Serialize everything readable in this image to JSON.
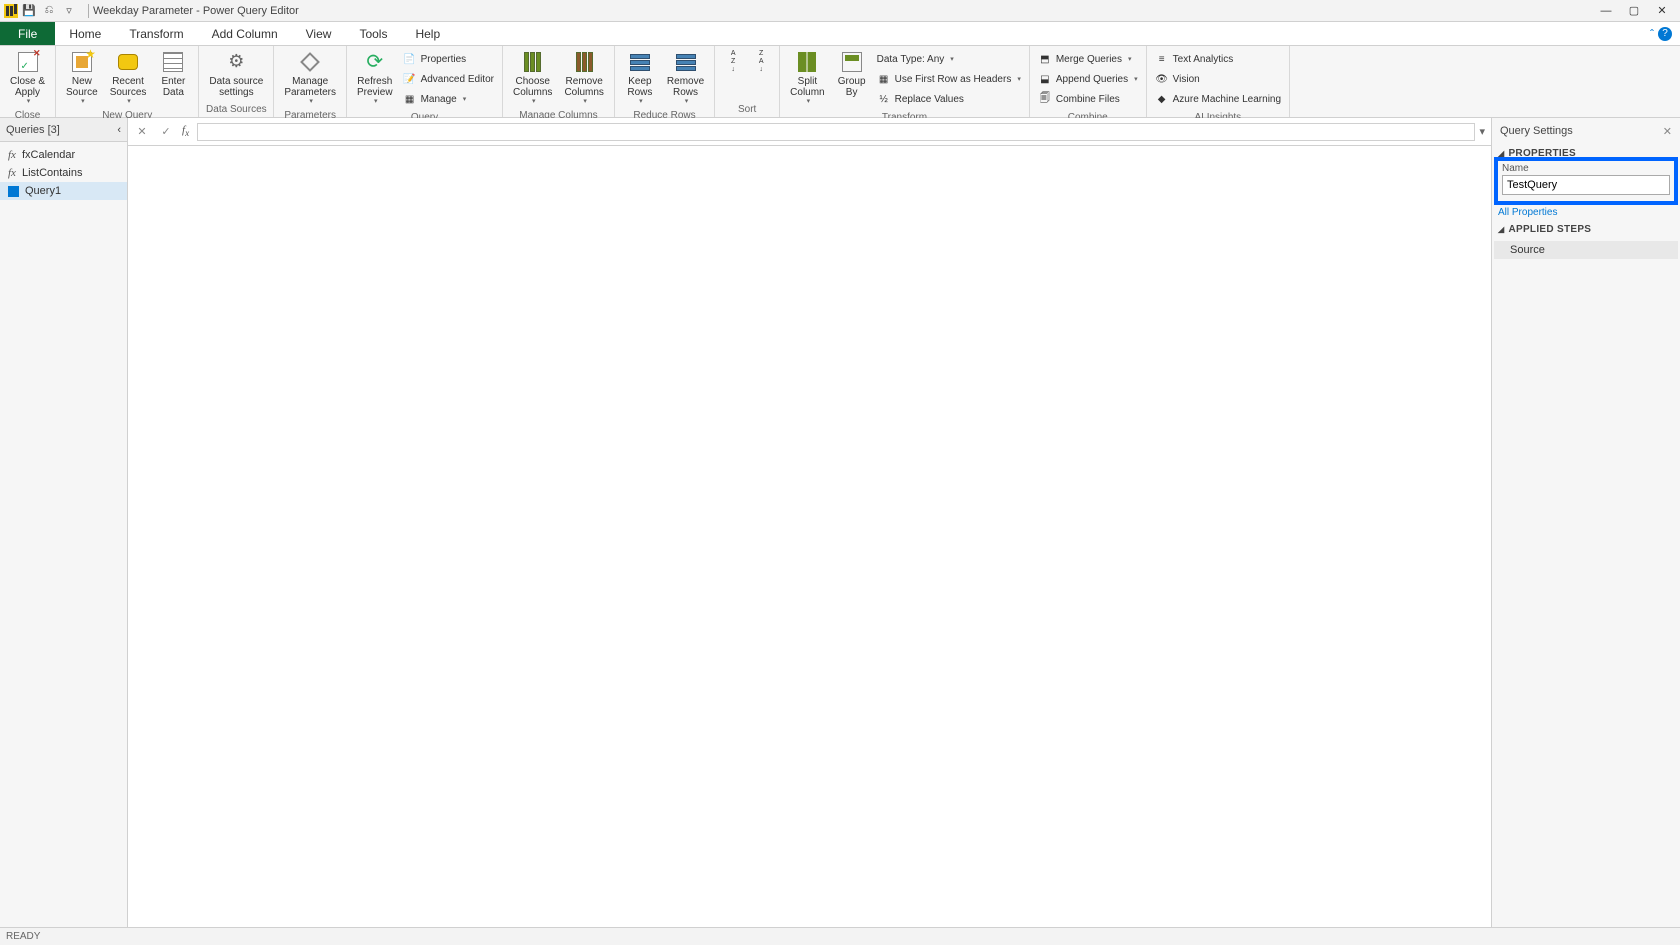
{
  "title": "Weekday Parameter - Power Query Editor",
  "menubar": {
    "file": "File",
    "tabs": [
      "Home",
      "Transform",
      "Add Column",
      "View",
      "Tools",
      "Help"
    ]
  },
  "ribbon": {
    "close": {
      "group": "Close",
      "close_apply": "Close &\nApply"
    },
    "new_query": {
      "group": "New Query",
      "new_source": "New\nSource",
      "recent_sources": "Recent\nSources",
      "enter_data": "Enter\nData"
    },
    "data_sources": {
      "group": "Data Sources",
      "settings": "Data source\nsettings"
    },
    "parameters": {
      "group": "Parameters",
      "manage": "Manage\nParameters"
    },
    "query": {
      "group": "Query",
      "refresh": "Refresh\nPreview",
      "properties": "Properties",
      "advanced": "Advanced Editor",
      "manage": "Manage"
    },
    "manage_columns": {
      "group": "Manage Columns",
      "choose": "Choose\nColumns",
      "remove": "Remove\nColumns"
    },
    "reduce_rows": {
      "group": "Reduce Rows",
      "keep": "Keep\nRows",
      "remove": "Remove\nRows"
    },
    "sort": {
      "group": "Sort"
    },
    "transform": {
      "group": "Transform",
      "split": "Split\nColumn",
      "group_by": "Group\nBy",
      "data_type": "Data Type: Any",
      "first_row": "Use First Row as Headers",
      "replace": "Replace Values"
    },
    "combine": {
      "group": "Combine",
      "merge": "Merge Queries",
      "append": "Append Queries",
      "files": "Combine Files"
    },
    "ai": {
      "group": "AI Insights",
      "text": "Text Analytics",
      "vision": "Vision",
      "ml": "Azure Machine Learning"
    }
  },
  "queries": {
    "header": "Queries [3]",
    "items": [
      {
        "name": "fxCalendar",
        "type": "fx"
      },
      {
        "name": "ListContains",
        "type": "fx"
      },
      {
        "name": "Query1",
        "type": "table",
        "selected": true
      }
    ]
  },
  "formula": "",
  "settings": {
    "title": "Query Settings",
    "properties_header": "PROPERTIES",
    "name_label": "Name",
    "name_value": "TestQuery",
    "all_properties": "All Properties",
    "applied_steps_header": "APPLIED STEPS",
    "steps": [
      "Source"
    ]
  },
  "status": "READY"
}
